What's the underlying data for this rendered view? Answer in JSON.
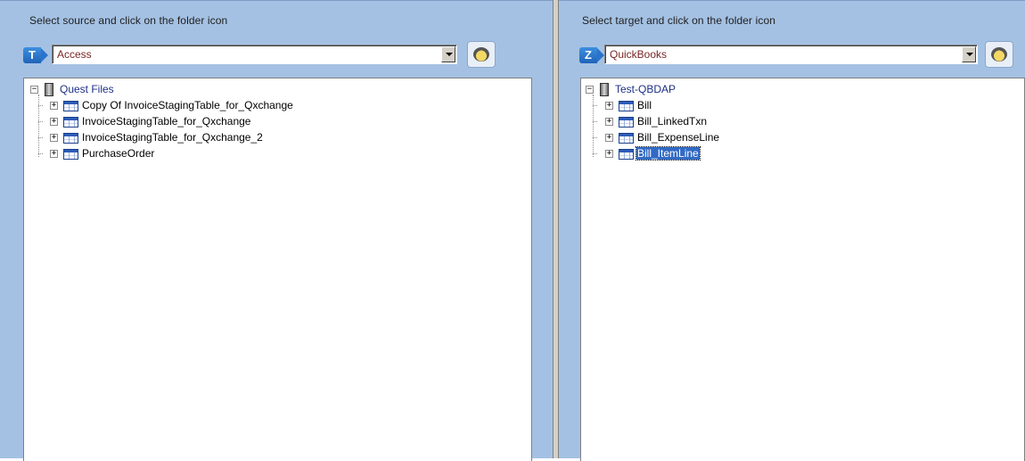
{
  "source": {
    "label": "Select source and click on the folder icon",
    "type_icon_letter": "T",
    "selected": "Access",
    "tree": {
      "root": "Quest Files",
      "items": [
        {
          "label": "Copy Of InvoiceStagingTable_for_Qxchange"
        },
        {
          "label": "InvoiceStagingTable_for_Qxchange"
        },
        {
          "label": "InvoiceStagingTable_for_Qxchange_2"
        },
        {
          "label": "PurchaseOrder"
        }
      ]
    }
  },
  "target": {
    "label": "Select target and click on the folder icon",
    "type_icon_letter": "Z",
    "selected": "QuickBooks",
    "tree": {
      "root": "Test-QBDAP",
      "items": [
        {
          "label": "Bill"
        },
        {
          "label": "Bill_LinkedTxn"
        },
        {
          "label": "Bill_ExpenseLine"
        },
        {
          "label": "Bill_ItemLine",
          "selected": true
        }
      ]
    }
  },
  "colors": {
    "pane_background": "#a4c1e3",
    "selection": "#316ac5",
    "root_text": "#1c2f86",
    "combo_text": "#7a2424"
  },
  "expander_collapsed": "+",
  "expander_expanded": "−"
}
